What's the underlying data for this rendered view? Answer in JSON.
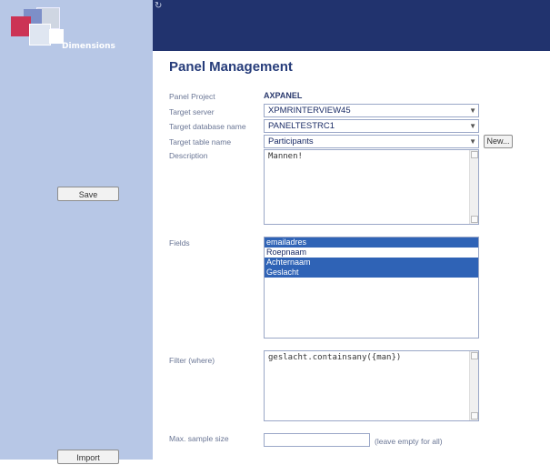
{
  "logo": {
    "text": "Dimensions"
  },
  "header": {
    "title": "Panel Management"
  },
  "sidebar": {
    "save_label": "Save",
    "import_label": "Import"
  },
  "form": {
    "panel_project": {
      "label": "Panel Project",
      "value": "AXPANEL"
    },
    "target_server": {
      "label": "Target server",
      "value": "XPMRINTERVIEW45"
    },
    "target_database": {
      "label": "Target database name",
      "value": "PANELTESTRC1"
    },
    "target_table": {
      "label": "Target table name",
      "value": "Participants",
      "new_button": "New..."
    },
    "description": {
      "label": "Description",
      "value": "Mannen!"
    },
    "fields": {
      "label": "Fields",
      "items": [
        {
          "label": "emailadres",
          "selected": true
        },
        {
          "label": "Roepnaam",
          "selected": false
        },
        {
          "label": "Achternaam",
          "selected": true
        },
        {
          "label": "Geslacht",
          "selected": true
        }
      ]
    },
    "filter": {
      "label": "Filter (where)",
      "value": "geslacht.containsany({man})"
    },
    "max_sample": {
      "label": "Max. sample size",
      "value": "",
      "hint": "(leave empty for all)"
    }
  },
  "colors": {
    "sidebar": "#b7c7e6",
    "topbar": "#21336e",
    "title": "#263c7a",
    "selected": "#2f63b6"
  },
  "icons": {
    "refresh": "refresh-icon",
    "dropdown": "chevron-down-icon"
  }
}
